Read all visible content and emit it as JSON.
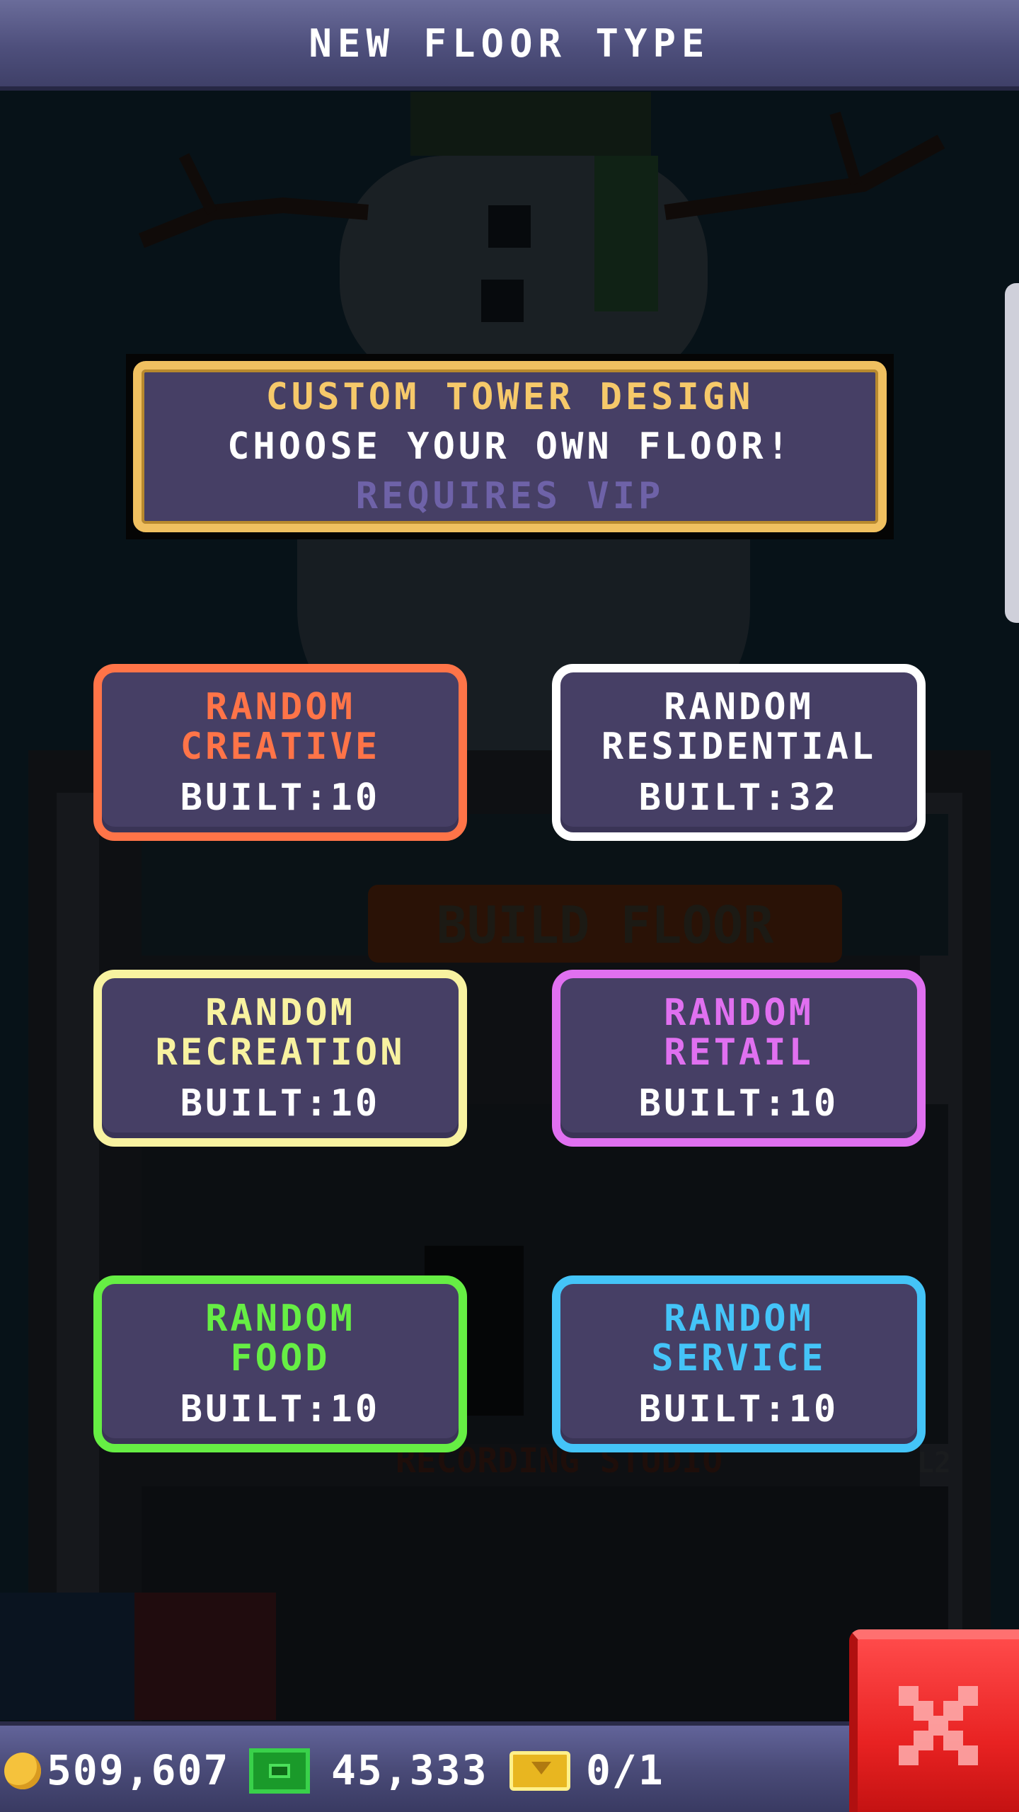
{
  "header": {
    "title": "NEW FLOOR TYPE"
  },
  "vip_card": {
    "title": "CUSTOM TOWER DESIGN",
    "subtitle": "CHOOSE YOUR OWN FLOOR!",
    "requirement": "REQUIRES VIP",
    "border_color": "#f0c060"
  },
  "floor_options": [
    {
      "line1": "RANDOM",
      "line2": "CREATIVE",
      "built": "BUILT:10",
      "color": "#ff7448"
    },
    {
      "line1": "RANDOM",
      "line2": "RESIDENTIAL",
      "built": "BUILT:32",
      "color": "#ffffff"
    },
    {
      "line1": "RANDOM",
      "line2": "RECREATION",
      "built": "BUILT:10",
      "color": "#f8f2a0"
    },
    {
      "line1": "RANDOM",
      "line2": "RETAIL",
      "built": "BUILT:10",
      "color": "#e070f0"
    },
    {
      "line1": "RANDOM",
      "line2": "FOOD",
      "built": "BUILT:10",
      "color": "#66ee44"
    },
    {
      "line1": "RANDOM",
      "line2": "SERVICE",
      "built": "BUILT:10",
      "color": "#44c4f8"
    }
  ],
  "background": {
    "build_floor_label": "BUILD FLOOR",
    "floor_label": "RECORDING STUDIO",
    "floor_number": "L2"
  },
  "status_bar": {
    "coins": "509,607",
    "bux": "45,333",
    "tickets": "0/1"
  },
  "icons": {
    "coin": "coin-icon",
    "cash": "cash-icon",
    "golden_ticket": "golden-ticket-icon",
    "close": "close-icon"
  }
}
